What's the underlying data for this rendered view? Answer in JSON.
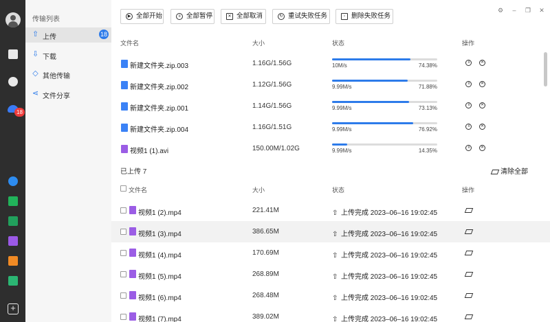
{
  "rail": {
    "cloud_badge": "18"
  },
  "nav": {
    "title": "传输列表",
    "items": [
      {
        "label": "上传",
        "icon": "upload-icon",
        "badge": "18"
      },
      {
        "label": "下载",
        "icon": "download-icon"
      },
      {
        "label": "其他传输",
        "icon": "diamond-icon"
      },
      {
        "label": "文件分享",
        "icon": "share-icon"
      }
    ]
  },
  "toolbar": {
    "start_all": "全部开始",
    "pause_all": "全部暂停",
    "cancel_all": "全部取消",
    "retry_failed": "重试失败任务",
    "delete_failed": "删除失败任务"
  },
  "uploading": {
    "columns": {
      "name": "文件名",
      "size": "大小",
      "status": "状态",
      "ops": "操作"
    },
    "rows": [
      {
        "name": "新建文件夹.zip.003",
        "size": "1.16G/1.56G",
        "speed": "10M/s",
        "percent": "74.38%",
        "progress": 0.7438,
        "type": "zip"
      },
      {
        "name": "新建文件夹.zip.002",
        "size": "1.12G/1.56G",
        "speed": "9.99M/s",
        "percent": "71.88%",
        "progress": 0.7188,
        "type": "zip"
      },
      {
        "name": "新建文件夹.zip.001",
        "size": "1.14G/1.56G",
        "speed": "9.99M/s",
        "percent": "73.13%",
        "progress": 0.7313,
        "type": "zip"
      },
      {
        "name": "新建文件夹.zip.004",
        "size": "1.16G/1.51G",
        "speed": "9.99M/s",
        "percent": "76.92%",
        "progress": 0.7692,
        "type": "zip"
      },
      {
        "name": "视频1 (1).avi",
        "size": "150.00M/1.02G",
        "speed": "9.99M/s",
        "percent": "14.35%",
        "progress": 0.1435,
        "type": "video"
      }
    ]
  },
  "uploaded": {
    "title": "已上传 7",
    "clear_all": "清除全部",
    "columns": {
      "name": "文件名",
      "size": "大小",
      "status": "状态",
      "ops": "操作"
    },
    "rows": [
      {
        "name": "视频1 (2).mp4",
        "size": "221.41M",
        "status": "上传完成",
        "time": "2023–06–16 19:02:45"
      },
      {
        "name": "视频1 (3).mp4",
        "size": "386.65M",
        "status": "上传完成",
        "time": "2023–06–16 19:02:45"
      },
      {
        "name": "视频1 (4).mp4",
        "size": "170.69M",
        "status": "上传完成",
        "time": "2023–06–16 19:02:45"
      },
      {
        "name": "视频1 (5).mp4",
        "size": "268.89M",
        "status": "上传完成",
        "time": "2023–06–16 19:02:45"
      },
      {
        "name": "视频1 (6).mp4",
        "size": "268.48M",
        "status": "上传完成",
        "time": "2023–06–16 19:02:45"
      },
      {
        "name": "视频1 (7).mp4",
        "size": "389.02M",
        "status": "上传完成",
        "time": "2023–06–16 19:02:45"
      }
    ]
  }
}
